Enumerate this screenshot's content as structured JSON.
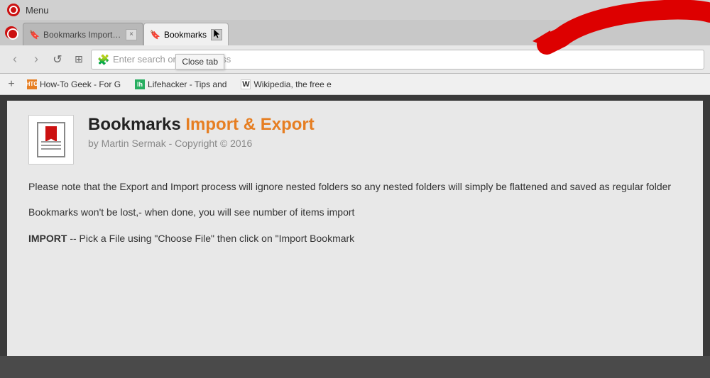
{
  "titleBar": {
    "menuLabel": "Menu"
  },
  "tabBar": {
    "tab1": {
      "label": "Bookmarks Import & Expo",
      "faviconChar": "🔖"
    },
    "tab2": {
      "label": "Bookmarks",
      "faviconChar": "🔖",
      "closeLabel": "×"
    },
    "tooltip": "Close tab"
  },
  "addressBar": {
    "back": "‹",
    "forward": "›",
    "reload": "↺",
    "grid": "⊞",
    "placeholder": "Enter search or web address"
  },
  "bookmarksBar": {
    "addLabel": "+",
    "items": [
      {
        "id": "htg",
        "label": "How-To Geek - For G",
        "short": "HTG"
      },
      {
        "id": "lh",
        "label": "Lifehacker - Tips and",
        "short": "lh"
      },
      {
        "id": "wiki",
        "label": "Wikipedia, the free e",
        "short": "W"
      }
    ]
  },
  "page": {
    "title1": "Bookmarks ",
    "titleOrange": "Import & Export",
    "subtitle": "by Martin Sermak - Copyright © 2016",
    "para1": "Please note that the Export and Import process will ignore nested folders so any nested folders will simply be flattened and saved as regular folder",
    "para2": "Bookmarks won't be lost,- when done, you will see number of items import",
    "para3Bold": "IMPORT",
    "para3Rest": " -- Pick a File using \"Choose File\" then click on \"Import Bookmark"
  }
}
